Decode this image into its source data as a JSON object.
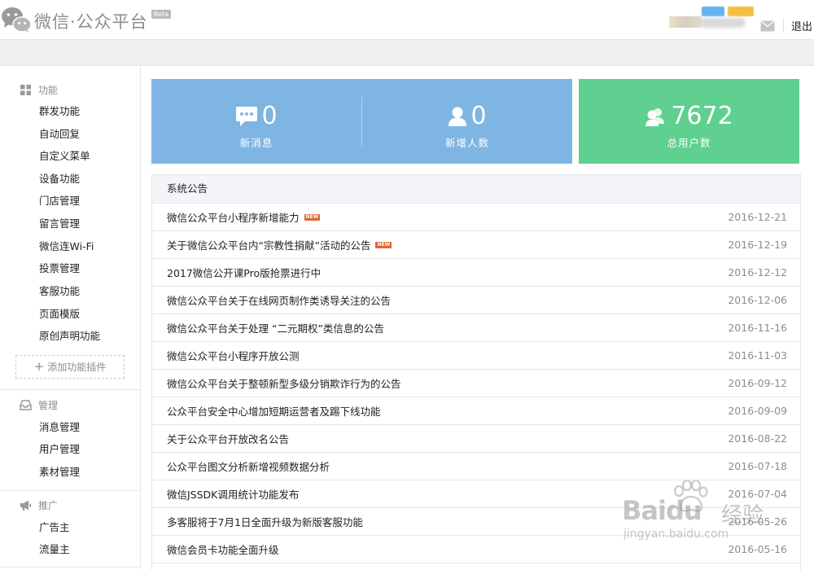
{
  "header": {
    "app_title": "微信·公众平台",
    "beta_label": "Beta",
    "logout_label": "退出",
    "icons": {
      "logo": "wechat-logo-icon",
      "mail": "mail-icon"
    }
  },
  "sidebar": {
    "sections": [
      {
        "title": "功能",
        "icon": "grid-icon",
        "items": [
          "群发功能",
          "自动回复",
          "自定义菜单",
          "设备功能",
          "门店管理",
          "留言管理",
          "微信连Wi-Fi",
          "投票管理",
          "客服功能",
          "页面模版",
          "原创声明功能"
        ]
      },
      {
        "title": "管理",
        "icon": "inbox-icon",
        "items": [
          "消息管理",
          "用户管理",
          "素材管理"
        ]
      },
      {
        "title": "推广",
        "icon": "megaphone-icon",
        "items": [
          "广告主",
          "流量主"
        ]
      }
    ],
    "add_plugin_label": "添加功能插件"
  },
  "stats": {
    "new_messages": {
      "value": "0",
      "label": "新消息",
      "icon": "chat-bubble-icon"
    },
    "new_users": {
      "value": "0",
      "label": "新增人数",
      "icon": "person-icon"
    },
    "total_users": {
      "value": "7672",
      "label": "总用户数",
      "icon": "people-icon"
    },
    "colors": {
      "blue_card": "#7fb5e3",
      "green_card": "#5fd090"
    }
  },
  "notices": {
    "header": "系统公告",
    "new_badge": "NEW",
    "rows": [
      {
        "title": "微信公众平台小程序新增能力",
        "date": "2016-12-21",
        "is_new": true
      },
      {
        "title": "关于微信公众平台内“宗教性捐献”活动的公告",
        "date": "2016-12-19",
        "is_new": true
      },
      {
        "title": "2017微信公开课Pro版抢票进行中",
        "date": "2016-12-12",
        "is_new": false
      },
      {
        "title": "微信公众平台关于在线网页制作类诱导关注的公告",
        "date": "2016-12-06",
        "is_new": false
      },
      {
        "title": "微信公众平台关于处理 “二元期权”类信息的公告",
        "date": "2016-11-16",
        "is_new": false
      },
      {
        "title": "微信公众平台小程序开放公测",
        "date": "2016-11-03",
        "is_new": false
      },
      {
        "title": "微信公众平台关于整顿新型多级分销欺诈行为的公告",
        "date": "2016-09-12",
        "is_new": false
      },
      {
        "title": "公众平台安全中心增加短期运营者及踢下线功能",
        "date": "2016-09-09",
        "is_new": false
      },
      {
        "title": "关于公众平台开放改名公告",
        "date": "2016-08-22",
        "is_new": false
      },
      {
        "title": "公众平台图文分析新增视频数据分析",
        "date": "2016-07-18",
        "is_new": false
      },
      {
        "title": "微信JSSDK调用统计功能发布",
        "date": "2016-07-04",
        "is_new": false
      },
      {
        "title": "多客服将于7月1日全面升级为新版客服功能",
        "date": "2016-05-26",
        "is_new": false
      },
      {
        "title": "微信会员卡功能全面升级",
        "date": "2016-05-16",
        "is_new": false
      }
    ]
  },
  "watermark": {
    "brand": "Baidu",
    "cn": "经验",
    "url": "jingyan.baidu.com"
  }
}
